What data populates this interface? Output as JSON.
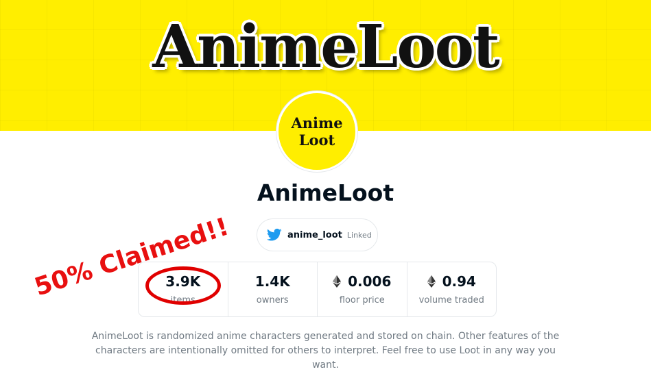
{
  "banner": {
    "logo_text": "AnimeLoot"
  },
  "avatar": {
    "line1": "Anime",
    "line2": "Loot"
  },
  "collection": {
    "title": "AnimeLoot"
  },
  "social": {
    "icon": "twitter-bird-icon",
    "handle": "anime_loot",
    "status": "Linked"
  },
  "stats": [
    {
      "value": "3.9K",
      "label": "items",
      "eth": false
    },
    {
      "value": "1.4K",
      "label": "owners",
      "eth": false
    },
    {
      "value": "0.006",
      "label": "floor price",
      "eth": true
    },
    {
      "value": "0.94",
      "label": "volume traded",
      "eth": true
    }
  ],
  "annotation": {
    "text": "50% Claimed!!",
    "color": "#e81010"
  },
  "description": "AnimeLoot is randomized anime characters generated and stored on chain. Other features of the characters are intentionally omitted for others to interpret. Feel free to use Loot in any way you want.",
  "colors": {
    "banner": "#ffee00",
    "twitter": "#1d9bf0",
    "text": "#04111d",
    "muted": "#707a83"
  }
}
